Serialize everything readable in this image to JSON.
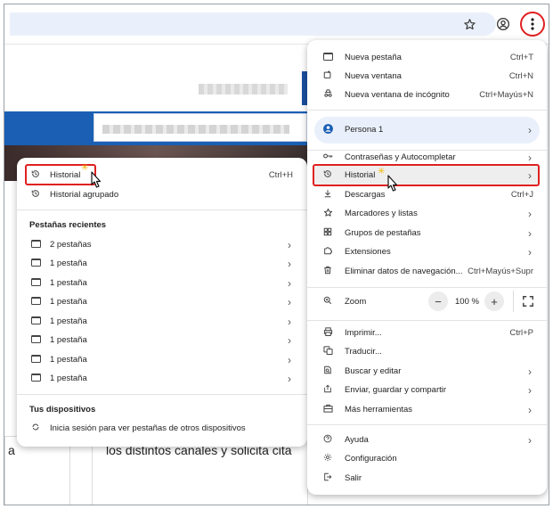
{
  "toolbar": {
    "star_icon": "star-outline-icon",
    "profile_icon": "account-circle-icon",
    "menu_icon": "vertical-dots-icon",
    "highlight_color": "#e02020"
  },
  "background": {
    "text_left": "a",
    "text_card": "los distintos canales y solicita cita",
    "accent_color": "#1a5fb4"
  },
  "history_submenu": {
    "top_items": [
      {
        "label": "Historial",
        "shortcut": "Ctrl+H"
      },
      {
        "label": "Historial agrupado",
        "shortcut": ""
      }
    ],
    "recent_title": "Pestañas recientes",
    "recent_items": [
      {
        "label": "2 pestañas"
      },
      {
        "label": "1 pestaña"
      },
      {
        "label": "1 pestaña"
      },
      {
        "label": "1 pestaña"
      },
      {
        "label": "1 pestaña"
      },
      {
        "label": "1 pestaña"
      },
      {
        "label": "1 pestaña"
      },
      {
        "label": "1 pestaña"
      }
    ],
    "devices_title": "Tus dispositivos",
    "devices_item": "Inicia sesión para ver pestañas de otros dispositivos"
  },
  "main_menu": {
    "group1": [
      {
        "label": "Nueva pestaña",
        "shortcut": "Ctrl+T",
        "icon": "new-tab-icon"
      },
      {
        "label": "Nueva ventana",
        "shortcut": "Ctrl+N",
        "icon": "new-window-icon"
      },
      {
        "label": "Nueva ventana de incógnito",
        "shortcut": "Ctrl+Mayús+N",
        "icon": "incognito-icon"
      }
    ],
    "persona": "Persona 1",
    "group2": [
      {
        "label": "Contraseñas y Autocompletar",
        "icon": "key-icon"
      },
      {
        "label": "Historial",
        "icon": "history-icon"
      },
      {
        "label": "Descargas",
        "shortcut": "Ctrl+J",
        "icon": "download-icon"
      },
      {
        "label": "Marcadores y listas",
        "icon": "bookmark-star-icon"
      },
      {
        "label": "Grupos de pestañas",
        "icon": "tab-groups-icon"
      },
      {
        "label": "Extensiones",
        "icon": "extension-icon"
      },
      {
        "label": "Eliminar datos de navegación...",
        "shortcut": "Ctrl+Mayús+Supr",
        "icon": "trash-icon"
      }
    ],
    "zoom": {
      "label": "Zoom",
      "minus": "−",
      "value": "100 %",
      "plus": "+"
    },
    "group3": [
      {
        "label": "Imprimir...",
        "shortcut": "Ctrl+P",
        "icon": "print-icon"
      },
      {
        "label": "Traducir...",
        "icon": "translate-icon"
      },
      {
        "label": "Buscar y editar",
        "icon": "search-edit-icon"
      },
      {
        "label": "Enviar, guardar y compartir",
        "icon": "share-icon"
      },
      {
        "label": "Más herramientas",
        "icon": "toolbox-icon"
      }
    ],
    "group4": [
      {
        "label": "Ayuda",
        "icon": "help-icon"
      },
      {
        "label": "Configuración",
        "icon": "settings-icon"
      },
      {
        "label": "Salir",
        "icon": "exit-icon"
      }
    ]
  }
}
